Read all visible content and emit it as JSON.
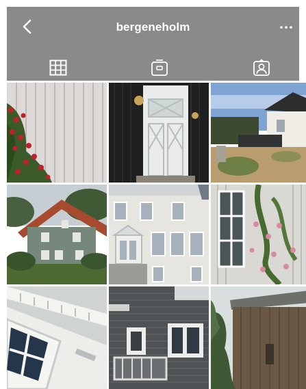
{
  "header": {
    "username": "bergeneholm",
    "back_icon": "chevron-left-icon",
    "more_icon": "more-dots-icon"
  },
  "tabs": [
    {
      "name": "grid",
      "icon": "grid-icon",
      "active": true
    },
    {
      "name": "feed",
      "icon": "feed-icon",
      "active": false
    },
    {
      "name": "tagged",
      "icon": "tagged-user-icon",
      "active": false
    }
  ],
  "colors": {
    "header_bg": "#8a8a8a",
    "icon": "#ffffff",
    "background": "#ffffff"
  }
}
